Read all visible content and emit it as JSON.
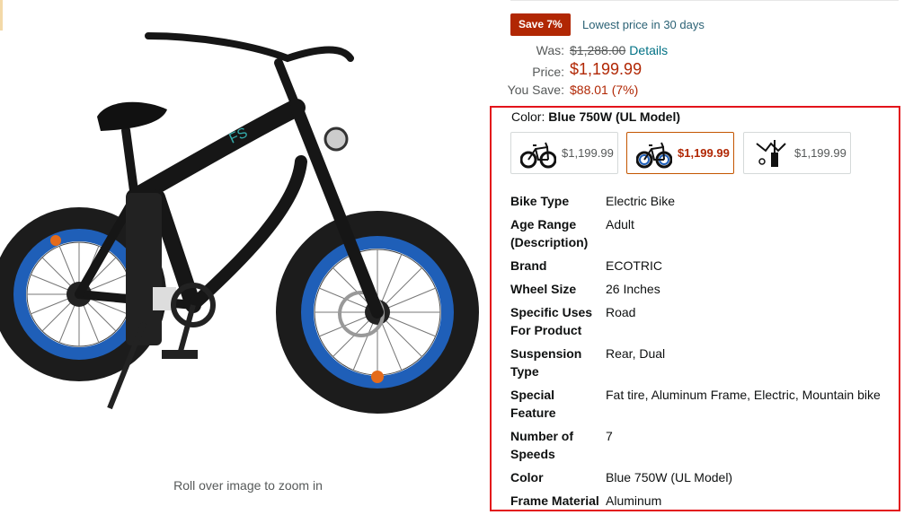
{
  "image_pane": {
    "zoom_hint": "Roll over image to zoom in",
    "image_alt": "ECOTRIC fat tire electric bike with blue rims"
  },
  "pricing": {
    "deal_badge": "Save 7%",
    "lowest_price_note": "Lowest price in 30 days",
    "was_label": "Was:",
    "was_value": "$1,288.00",
    "details_link": "Details",
    "price_label": "Price:",
    "price_value": "$1,199.99",
    "save_label": "You Save:",
    "save_value": "$88.01 (7%)"
  },
  "variant": {
    "color_label": "Color:",
    "color_value": "Blue 750W (UL Model)",
    "swatches": [
      {
        "price": "$1,199.99",
        "icon": "bike-thumbnail-icon",
        "selected": false
      },
      {
        "price": "$1,199.99",
        "icon": "bike-thumbnail-icon",
        "selected": true
      },
      {
        "price": "$1,199.99",
        "icon": "folding-bike-thumbnail-icon",
        "selected": false
      }
    ]
  },
  "specs": [
    {
      "key": "Bike Type",
      "value": "Electric Bike"
    },
    {
      "key": "Age Range (Description)",
      "value": "Adult"
    },
    {
      "key": "Brand",
      "value": "ECOTRIC"
    },
    {
      "key": "Wheel Size",
      "value": "26 Inches"
    },
    {
      "key": "Specific Uses For Product",
      "value": "Road"
    },
    {
      "key": "Suspension Type",
      "value": "Rear, Dual"
    },
    {
      "key": "Special Feature",
      "value": "Fat tire, Aluminum Frame, Electric, Mountain bike"
    },
    {
      "key": "Number of Speeds",
      "value": "7"
    },
    {
      "key": "Color",
      "value": "Blue 750W (UL Model)"
    },
    {
      "key": "Frame Material",
      "value": "Aluminum"
    }
  ],
  "colors": {
    "deal_red": "#b12704",
    "link_teal": "#007185",
    "highlight_red": "#e3141b",
    "rim_blue": "#1f5fb8"
  }
}
